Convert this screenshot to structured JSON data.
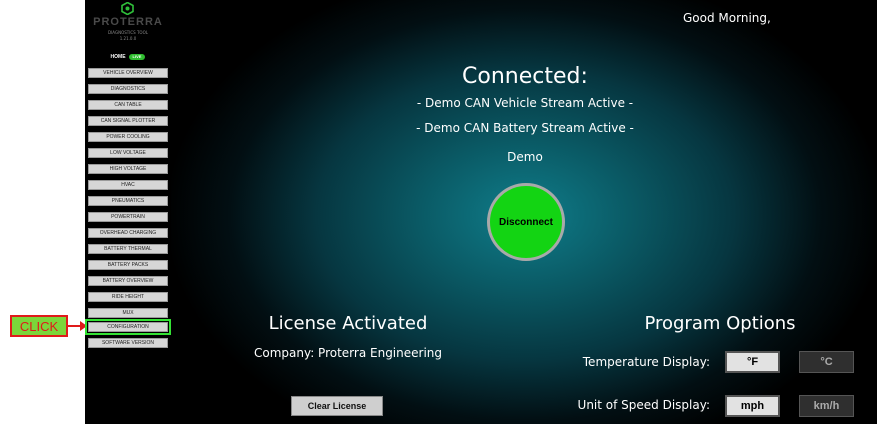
{
  "sidebar": {
    "logo_name": "PROTERRA",
    "logo_subtitle": "DIAGNOSTICS TOOL",
    "version": "1.21.0.0",
    "home_label": "HOME",
    "home_badge": "Live",
    "items": [
      {
        "label": "VEHICLE OVERVIEW"
      },
      {
        "label": "DIAGNOSTICS"
      },
      {
        "label": "CAN TABLE"
      },
      {
        "label": "CAN SIGNAL PLOTTER"
      },
      {
        "label": "POWER COOLING"
      },
      {
        "label": "LOW VOLTAGE"
      },
      {
        "label": "HIGH VOLTAGE"
      },
      {
        "label": "HVAC"
      },
      {
        "label": "PNEUMATICS"
      },
      {
        "label": "POWERTRAIN"
      },
      {
        "label": "OVERHEAD CHARGING"
      },
      {
        "label": "BATTERY THERMAL"
      },
      {
        "label": "BATTERY PACKS"
      },
      {
        "label": "BATTERY OVERVIEW"
      },
      {
        "label": "RIDE HEIGHT"
      },
      {
        "label": "MUX"
      },
      {
        "label": "CONFIGURATION"
      },
      {
        "label": "SOFTWARE VERSION"
      }
    ]
  },
  "header": {
    "greeting": "Good Morning,"
  },
  "status": {
    "title": "Connected:",
    "stream_vehicle": "- Demo CAN Vehicle Stream Active -",
    "stream_battery": "- Demo CAN Battery Stream Active -",
    "mode": "Demo",
    "disconnect_label": "Disconnect"
  },
  "license": {
    "title": "License Activated",
    "company": "Company: Proterra Engineering",
    "clear_label": "Clear License"
  },
  "options": {
    "title": "Program Options",
    "temperature_label": "Temperature Display:",
    "temp_f": "°F",
    "temp_c": "°C",
    "speed_label": "Unit of Speed Display:",
    "speed_mph": "mph",
    "speed_kmh": "km/h"
  },
  "annotation": {
    "callout": "CLICK"
  },
  "colors": {
    "connected_green": "#13d413",
    "highlight_green": "#34e234",
    "callout_red": "#e01a1a"
  }
}
